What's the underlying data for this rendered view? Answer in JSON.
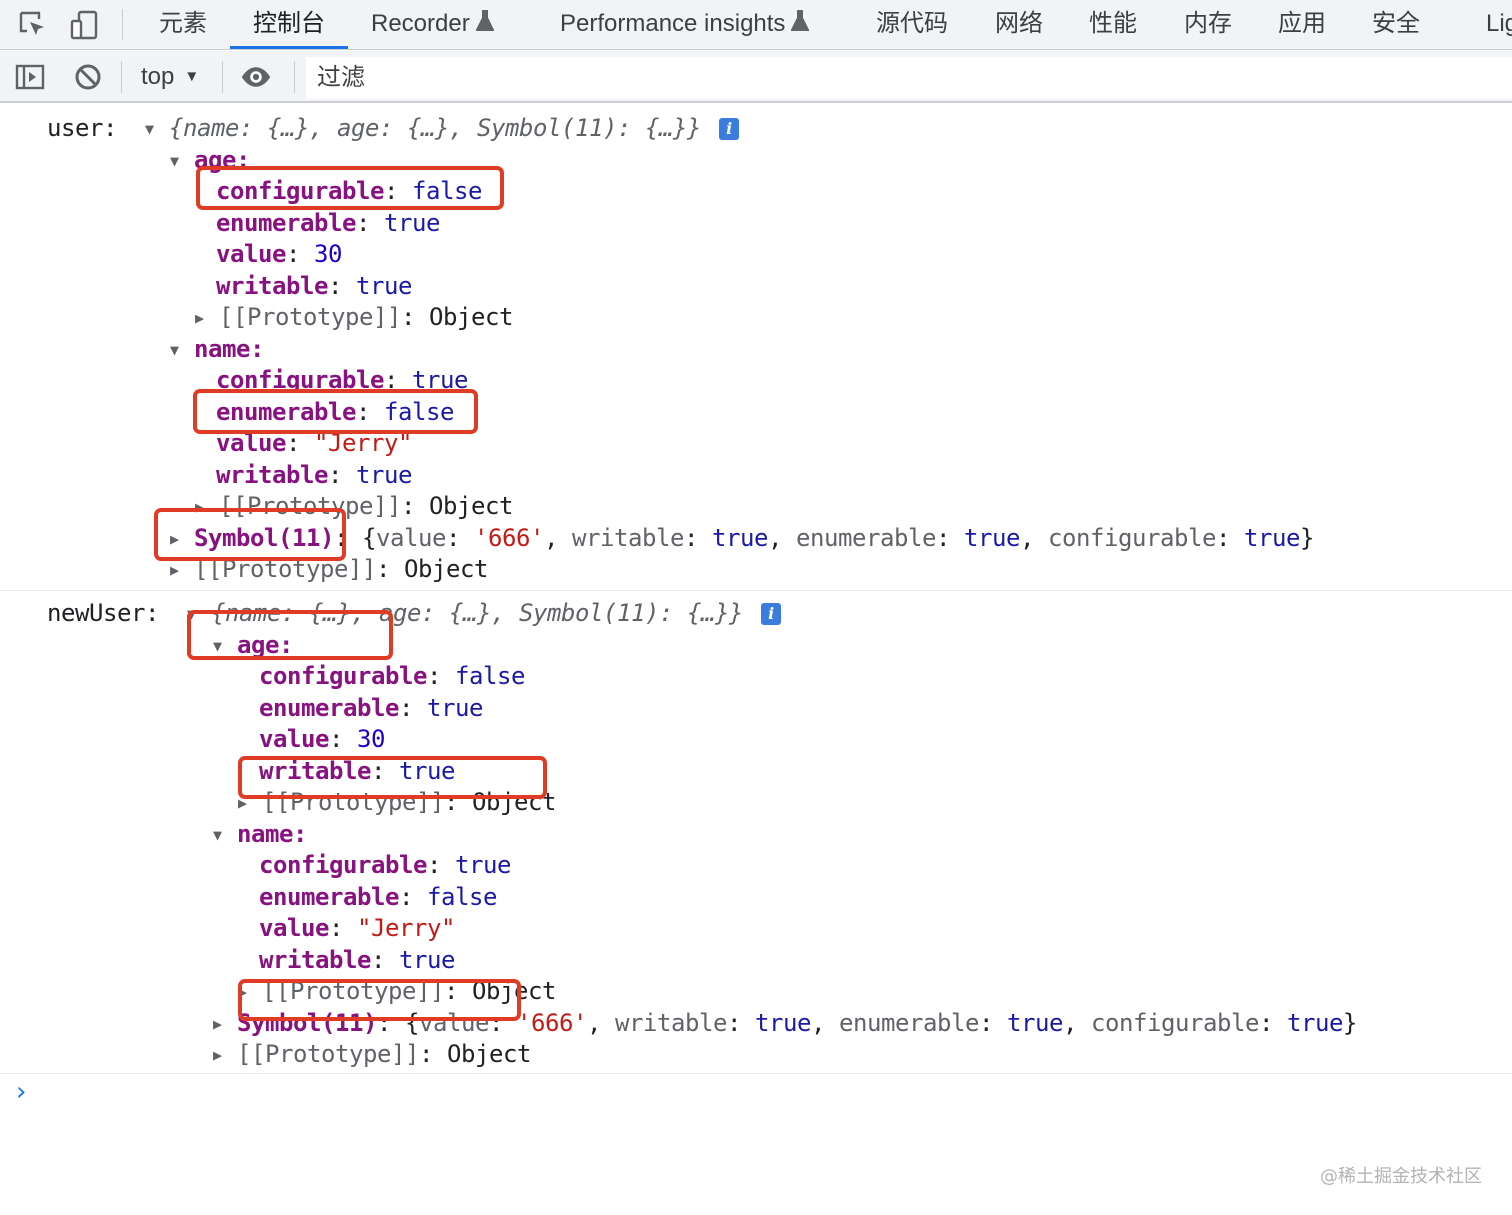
{
  "tabs": {
    "elements": "元素",
    "console": "控制台",
    "recorder": "Recorder",
    "performance_insights": "Performance insights",
    "sources": "源代码",
    "network": "网络",
    "performance": "性能",
    "memory": "内存",
    "application": "应用",
    "security": "安全",
    "lighthouse": "Lig"
  },
  "toolbar": {
    "context": "top",
    "filter_placeholder": "过滤"
  },
  "console": {
    "user": {
      "label": "user:",
      "summary": "{name: {…}, age: {…}, Symbol(11): {…}}",
      "info": "i",
      "age_key": "age:",
      "age": {
        "configurable_key": "configurable",
        "configurable_val": "false",
        "enumerable_key": "enumerable",
        "enumerable_val": "true",
        "value_key": "value",
        "value_val": "30",
        "writable_key": "writable",
        "writable_val": "true",
        "proto_key": "[[Prototype]]",
        "proto_val": "Object"
      },
      "name_key": "name:",
      "name": {
        "configurable_key": "configurable",
        "configurable_val": "true",
        "enumerable_key": "enumerable",
        "enumerable_val": "false",
        "value_key": "value",
        "value_val": "\"Jerry\"",
        "writable_key": "writable",
        "writable_val": "true",
        "proto_key": "[[Prototype]]",
        "proto_val": "Object"
      },
      "symbol_key": "Symbol(11)",
      "symbol": {
        "value_key": "value",
        "value_val": "'666'",
        "writable_key": "writable",
        "writable_val": "true",
        "enumerable_key": "enumerable",
        "enumerable_val": "true",
        "configurable_key": "configurable",
        "configurable_val": "true"
      },
      "proto_key": "[[Prototype]]",
      "proto_val": "Object"
    },
    "newUser": {
      "label": "newUser:",
      "summary": "{name: {…}, age: {…}, Symbol(11): {…}}",
      "info": "i",
      "age_key": "age:",
      "age": {
        "configurable_key": "configurable",
        "configurable_val": "false",
        "enumerable_key": "enumerable",
        "enumerable_val": "true",
        "value_key": "value",
        "value_val": "30",
        "writable_key": "writable",
        "writable_val": "true",
        "proto_key": "[[Prototype]]",
        "proto_val": "Object"
      },
      "name_key": "name:",
      "name": {
        "configurable_key": "configurable",
        "configurable_val": "true",
        "enumerable_key": "enumerable",
        "enumerable_val": "false",
        "value_key": "value",
        "value_val": "\"Jerry\"",
        "writable_key": "writable",
        "writable_val": "true",
        "proto_key": "[[Prototype]]",
        "proto_val": "Object"
      },
      "symbol_key": "Symbol(11)",
      "symbol": {
        "value_key": "value",
        "value_val": "'666'",
        "writable_key": "writable",
        "writable_val": "true",
        "enumerable_key": "enumerable",
        "enumerable_val": "true",
        "configurable_key": "configurable",
        "configurable_val": "true"
      },
      "proto_key": "[[Prototype]]",
      "proto_val": "Object"
    },
    "prompt_glyph": "›"
  },
  "watermark": "@稀土掘金技术社区",
  "colors": {
    "accent": "#1a73e8",
    "highlight_box": "#e03b24",
    "property_key": "#881280",
    "boolean": "#1a1aa6",
    "number": "#1c00cf",
    "string": "#c41a16"
  },
  "icons": [
    "inspect-element-icon",
    "device-toolbar-icon",
    "flask-icon",
    "sidebar-toggle-icon",
    "clear-console-icon",
    "eye-icon",
    "expand-triangle-icon",
    "collapse-triangle-icon",
    "info-icon",
    "prompt-chevron-icon"
  ]
}
